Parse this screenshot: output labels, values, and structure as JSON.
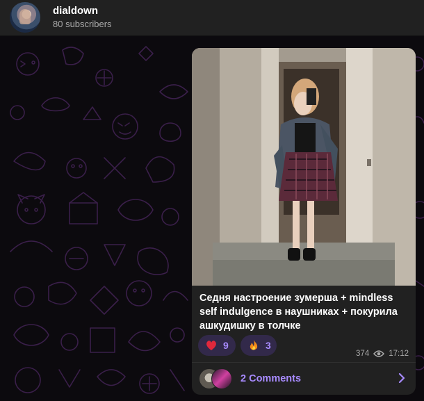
{
  "channel": {
    "name": "dialdown",
    "subscribers": "80 subscribers"
  },
  "post": {
    "caption": "Седня настроение зумерша + mindless self indulgence в наушниках + покурила ашкудишку в толчке",
    "reactions": [
      {
        "emoji": "heart-icon",
        "count": "9"
      },
      {
        "emoji": "fire-icon",
        "count": "3"
      }
    ],
    "views": "374",
    "time": "17:12",
    "comments_label": "2 Comments"
  },
  "colors": {
    "header_bg": "#212121",
    "bubble_bg": "#212121",
    "accent": "#a88bff",
    "reaction_bg": "#32294a",
    "muted_text": "#aaaaaa",
    "pattern_stroke": "#3a1f4a"
  }
}
